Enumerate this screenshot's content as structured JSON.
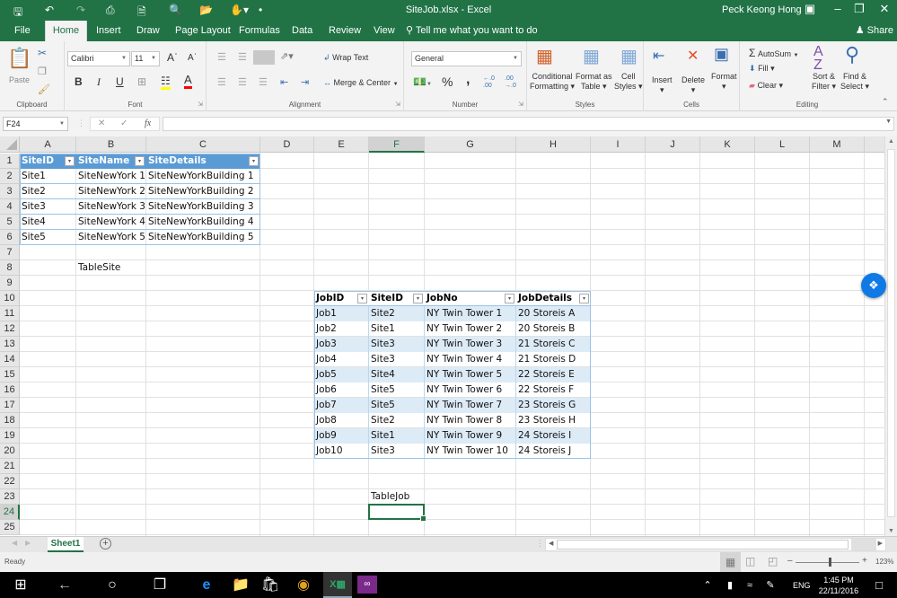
{
  "window": {
    "title": "SiteJob.xlsx  -  Excel",
    "user": "Peck Keong Hong",
    "share_label": "Share"
  },
  "quick_access": [
    "save-icon",
    "undo-icon",
    "redo-icon",
    "print-icon",
    "new-icon",
    "print-preview-icon",
    "open-icon",
    "touch-mode-icon"
  ],
  "tabs": [
    {
      "label": "File"
    },
    {
      "label": "Home",
      "active": true
    },
    {
      "label": "Insert"
    },
    {
      "label": "Draw"
    },
    {
      "label": "Page Layout"
    },
    {
      "label": "Formulas"
    },
    {
      "label": "Data"
    },
    {
      "label": "Review"
    },
    {
      "label": "View"
    }
  ],
  "tell_me": "Tell me what you want to do",
  "ribbon": {
    "clipboard": {
      "label": "Clipboard",
      "paste": "Paste"
    },
    "font": {
      "label": "Font",
      "name": "Calibri",
      "size": "11",
      "bold": "B",
      "italic": "I",
      "underline": "U"
    },
    "alignment": {
      "label": "Alignment",
      "wrap_text": "Wrap Text",
      "merge_center": "Merge & Center"
    },
    "number": {
      "label": "Number",
      "format": "General",
      "percent": "%",
      "comma": ","
    },
    "styles": {
      "label": "Styles",
      "conditional_1": "Conditional",
      "conditional_2": "Formatting",
      "format_as_1": "Format as",
      "format_as_2": "Table",
      "cell_styles_1": "Cell",
      "cell_styles_2": "Styles"
    },
    "cells": {
      "label": "Cells",
      "insert": "Insert",
      "delete": "Delete",
      "format": "Format"
    },
    "editing": {
      "label": "Editing",
      "autosum": "AutoSum",
      "fill": "Fill",
      "clear": "Clear",
      "sort_1": "Sort &",
      "sort_2": "Filter",
      "find_1": "Find &",
      "find_2": "Select"
    }
  },
  "formula_bar": {
    "name_box": "F24",
    "fx": "fx",
    "value": ""
  },
  "columns": [
    "A",
    "B",
    "C",
    "D",
    "E",
    "F",
    "G",
    "H",
    "I",
    "J",
    "K",
    "L",
    "M"
  ],
  "rows": [
    "1",
    "2",
    "3",
    "4",
    "5",
    "6",
    "7",
    "8",
    "9",
    "10",
    "11",
    "12",
    "13",
    "14",
    "15",
    "16",
    "17",
    "18",
    "19",
    "20",
    "21",
    "22",
    "23",
    "24",
    "25"
  ],
  "selected_cell": "F24",
  "table_site": {
    "headers": [
      "SiteID",
      "SiteName",
      "SiteDetails"
    ],
    "rows": [
      [
        "Site1",
        "SiteNewYork 1",
        "SiteNewYorkBuilding 1"
      ],
      [
        "Site2",
        "SiteNewYork 2",
        "SiteNewYorkBuilding 2"
      ],
      [
        "Site3",
        "SiteNewYork 3",
        "SiteNewYorkBuilding 3"
      ],
      [
        "Site4",
        "SiteNewYork 4",
        "SiteNewYorkBuilding 4"
      ],
      [
        "Site5",
        "SiteNewYork 5",
        "SiteNewYorkBuilding 5"
      ]
    ],
    "caption": "TableSite"
  },
  "table_job": {
    "headers": [
      "JobID",
      "SiteID",
      "JobNo",
      "JobDetails"
    ],
    "rows": [
      [
        "Job1",
        "Site2",
        "NY Twin Tower 1",
        "20 Storeis A"
      ],
      [
        "Job2",
        "Site1",
        "NY Twin Tower 2",
        "20 Storeis B"
      ],
      [
        "Job3",
        "Site3",
        "NY Twin Tower 3",
        "21 Storeis C"
      ],
      [
        "Job4",
        "Site3",
        "NY Twin Tower 4",
        "21 Storeis D"
      ],
      [
        "Job5",
        "Site4",
        "NY Twin Tower 5",
        "22 Storeis E"
      ],
      [
        "Job6",
        "Site5",
        "NY Twin Tower 6",
        "22 Storeis F"
      ],
      [
        "Job7",
        "Site5",
        "NY Twin Tower 7",
        "23 Storeis G"
      ],
      [
        "Job8",
        "Site2",
        "NY Twin Tower 8",
        "23 Storeis H"
      ],
      [
        "Job9",
        "Site1",
        "NY Twin Tower 9",
        "24 Storeis I"
      ],
      [
        "Job10",
        "Site3",
        "NY Twin Tower 10",
        "24 Storeis J"
      ]
    ],
    "caption": "TableJob"
  },
  "sheets": [
    {
      "label": "Sheet1",
      "active": true
    }
  ],
  "status": {
    "text": "Ready",
    "zoom": "123%",
    "zoom_value_percent": 123
  },
  "taskbar": {
    "time": "1:45 PM",
    "date": "22/11/2016",
    "lang": "ENG"
  },
  "colors": {
    "excel_green": "#217346",
    "table_header": "#5b9bd5",
    "table_band": "#ddebf7"
  }
}
